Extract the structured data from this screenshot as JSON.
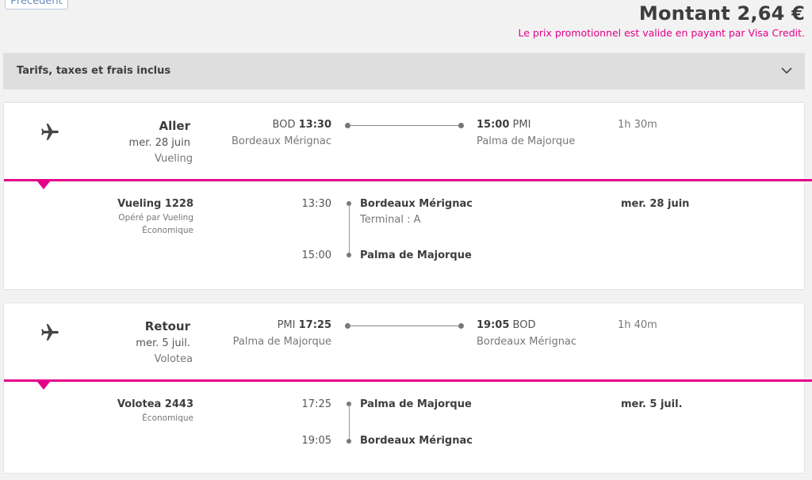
{
  "header": {
    "prev_button_label": "Précédent",
    "amount": "Montant 2,64 €",
    "promo_text": "Le prix promotionnel est valide en payant par Visa Credit."
  },
  "fees_accordion": {
    "label": "Tarifs, taxes et frais inclus"
  },
  "outbound": {
    "direction": "Aller",
    "date": "mer. 28 juin",
    "airline": "Vueling",
    "from_code": "BOD",
    "from_time": "13:30",
    "from_city": "Bordeaux Mérignac",
    "to_time": "15:00",
    "to_code": "PMI",
    "to_city": "Palma de Majorque",
    "duration": "1h 30m",
    "detail": {
      "flight": "Vueling 1228",
      "operated_by": "Opéré par Vueling",
      "cabin": "Économique",
      "dep_time": "13:30",
      "dep_airport": "Bordeaux Mérignac",
      "terminal": "Terminal : A",
      "arr_time": "15:00",
      "arr_airport": "Palma de Majorque",
      "date": "mer. 28 juin"
    }
  },
  "return": {
    "direction": "Retour",
    "date": "mer. 5 juil.",
    "airline": "Volotea",
    "from_code": "PMI",
    "from_time": "17:25",
    "from_city": "Palma de Majorque",
    "to_time": "19:05",
    "to_code": "BOD",
    "to_city": "Bordeaux Mérignac",
    "duration": "1h 40m",
    "detail": {
      "flight": "Volotea 2443",
      "cabin": "Économique",
      "dep_time": "17:25",
      "dep_airport": "Palma de Majorque",
      "arr_time": "19:05",
      "arr_airport": "Bordeaux Mérignac",
      "date": "mer. 5 juil."
    }
  },
  "colors": {
    "accent": "#e5008a",
    "text": "#3d3d3d",
    "muted": "#777777"
  },
  "icons": {
    "plane": "airplane-icon",
    "chevron": "chevron-down-icon"
  }
}
